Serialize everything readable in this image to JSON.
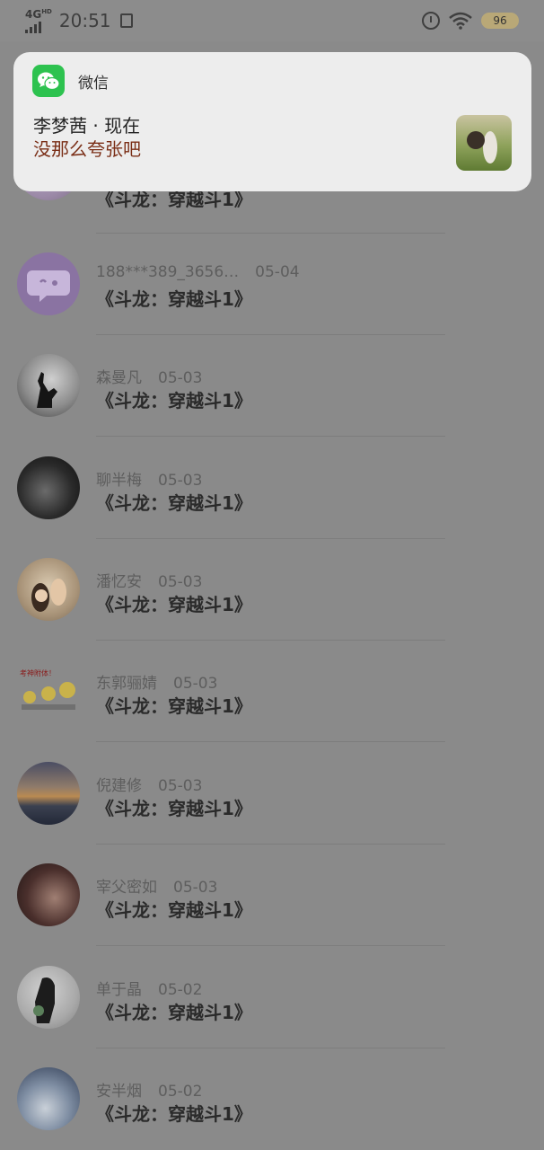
{
  "status_bar": {
    "network": "4G",
    "network_hd": "HD",
    "time": "20:51",
    "battery": "96"
  },
  "notification": {
    "app_name": "微信",
    "sender": "李梦茜 · 现在",
    "message": "没那么夸张吧"
  },
  "list": {
    "items": [
      {
        "name": "",
        "date": "",
        "title": "《斗龙：穿越斗1》"
      },
      {
        "name": "188***389_3656…",
        "date": "05-04",
        "title": "《斗龙：穿越斗1》"
      },
      {
        "name": "森曼凡",
        "date": "05-03",
        "title": "《斗龙：穿越斗1》"
      },
      {
        "name": "聊半梅",
        "date": "05-03",
        "title": "《斗龙：穿越斗1》"
      },
      {
        "name": "潘忆安",
        "date": "05-03",
        "title": "《斗龙：穿越斗1》"
      },
      {
        "name": "东郭骊婧",
        "date": "05-03",
        "title": "《斗龙：穿越斗1》"
      },
      {
        "name": "倪建修",
        "date": "05-03",
        "title": "《斗龙：穿越斗1》"
      },
      {
        "name": "宰父密如",
        "date": "05-03",
        "title": "《斗龙：穿越斗1》"
      },
      {
        "name": "单于晶",
        "date": "05-02",
        "title": "《斗龙：穿越斗1》"
      },
      {
        "name": "安半烟",
        "date": "05-02",
        "title": "《斗龙：穿越斗1》"
      }
    ],
    "avatar_5_caption": "考神附体！"
  }
}
